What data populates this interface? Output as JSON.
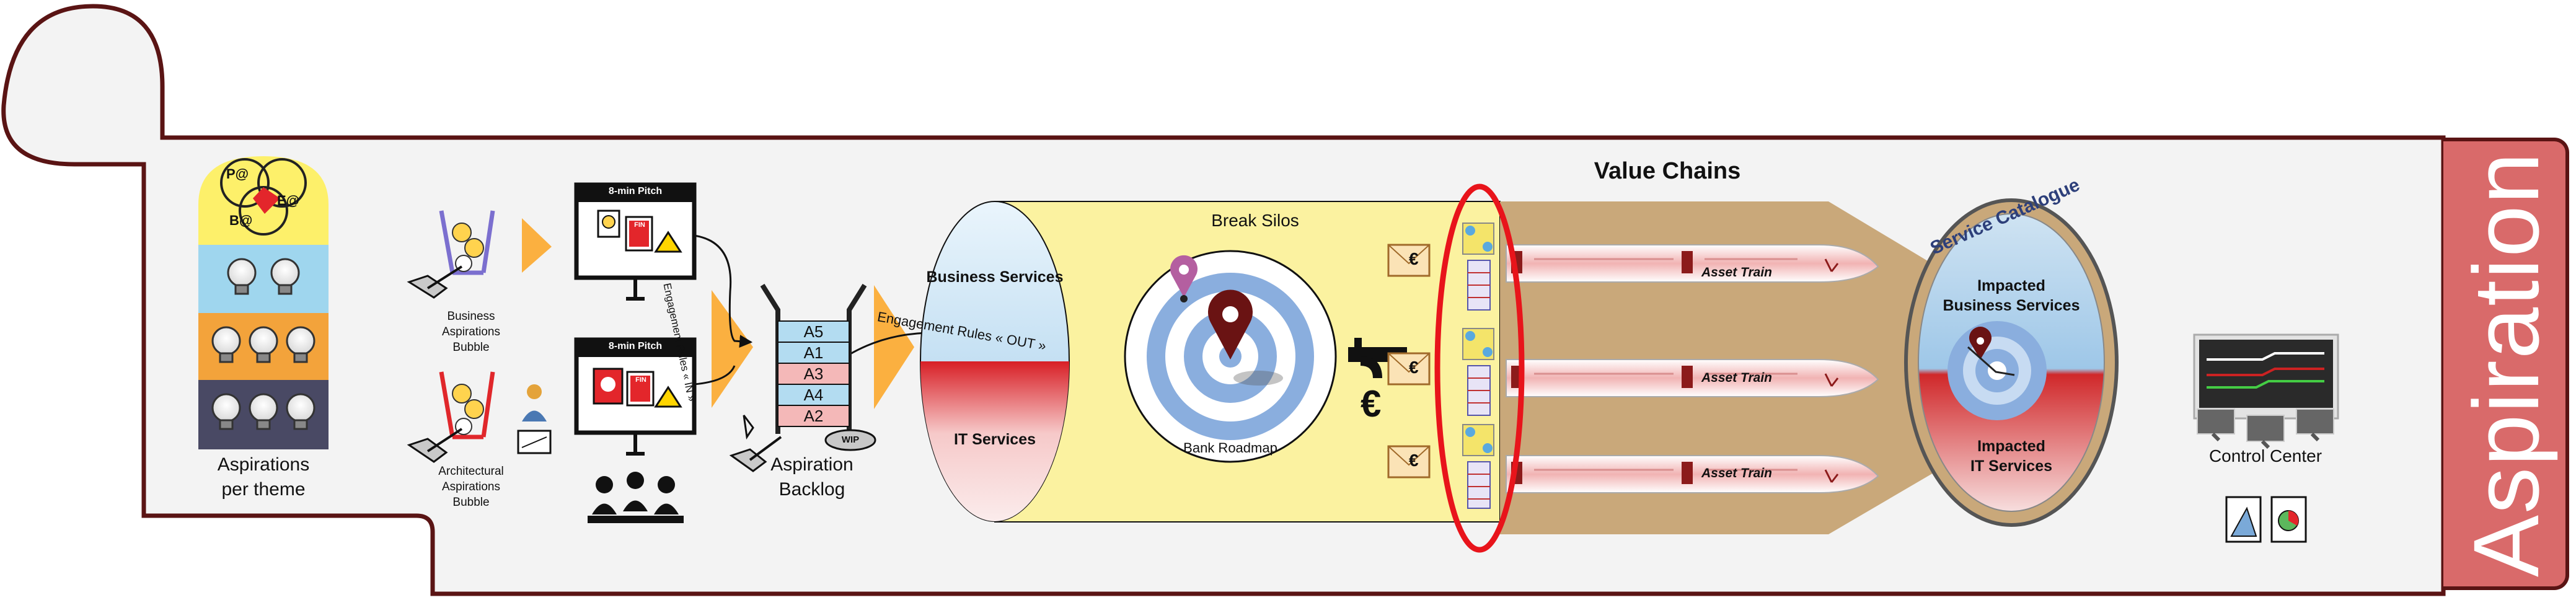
{
  "themes": {
    "levels": [
      "P@",
      "E@",
      "B@"
    ],
    "caption_line1": "Aspirations",
    "caption_line2": "per theme"
  },
  "bubbles": {
    "business": [
      "Business",
      "Aspirations",
      "Bubble"
    ],
    "architectural": [
      "Architectural",
      "Aspirations",
      "Bubble"
    ]
  },
  "pitch": {
    "title": "8-min Pitch",
    "card_text": "FIN"
  },
  "backlog": {
    "items": [
      "A5",
      "A1",
      "A3",
      "A4",
      "A2"
    ],
    "wip": "WIP",
    "caption_line1": "Aspiration",
    "caption_line2": "Backlog"
  },
  "rules": {
    "in": "Engagement Rules « IN »",
    "out": "Engagement Rules «  OUT  »"
  },
  "silos": {
    "title": "Break Silos",
    "business": "Business Services",
    "it": "IT Services",
    "roadmap": "Bank Roadmap",
    "euro": "€"
  },
  "value_chains": {
    "title": "Value Chains",
    "train_label": "Asset Train",
    "envelope_euro": "€"
  },
  "catalogue": {
    "title": "Service Catalogue",
    "business_line1": "Impacted",
    "business_line2": "Business Services",
    "it_line1": "Impacted",
    "it_line2": "IT Services"
  },
  "control": {
    "label": "Control Center"
  },
  "banner": {
    "label": "Aspiration"
  },
  "colors": {
    "outline": "#5a1414",
    "panel": "#f3f3f3",
    "banner": "#d96a6a",
    "yellow": "#fbf2a0",
    "orange": "#f7a23b",
    "value_chain": "#c9a87a",
    "highlight": "#e8141b",
    "business_blue": "#b8d8ee",
    "it_red": "#d8282a"
  }
}
